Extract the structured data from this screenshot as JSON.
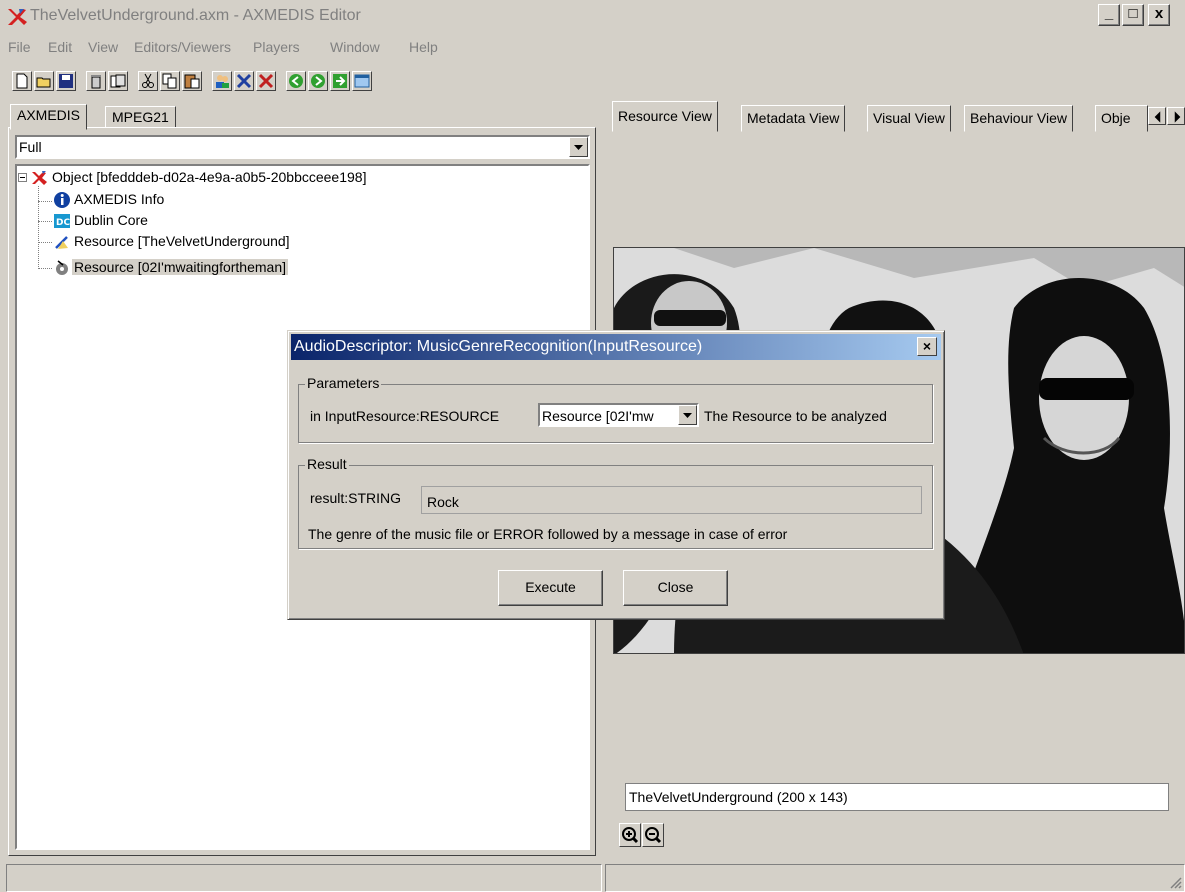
{
  "window": {
    "title": "TheVelvetUnderground.axm - AXMEDIS Editor",
    "caption_buttons": {
      "minimize": "_",
      "maximize": "□",
      "close": "x"
    }
  },
  "menu": [
    "File",
    "Edit",
    "View",
    "Editors/Viewers",
    "Players",
    "Window",
    "Help"
  ],
  "toolbar": {
    "icons": [
      "new-file-icon",
      "open-folder-icon",
      "save-icon",
      "trash-icon",
      "cards-icon",
      "cut-icon",
      "copy-icon",
      "paste-icon",
      "people-icon",
      "tool-blue-icon",
      "tool-red-icon",
      "back-green-icon",
      "forward-green-icon",
      "enter-icon",
      "window-icon"
    ]
  },
  "left_panel": {
    "tabs": [
      "AXMEDIS",
      "MPEG21"
    ],
    "active_tab": "AXMEDIS",
    "filter": {
      "value": "Full"
    },
    "tree": {
      "root": {
        "label": "Object [bfedddeb-d02a-4e9a-a0b5-20bbcceee198]",
        "icon": "axmedis-object-icon"
      },
      "children": [
        {
          "label": "AXMEDIS Info",
          "icon": "info-icon"
        },
        {
          "label": "Dublin Core",
          "icon": "dublin-core-icon"
        },
        {
          "label": "Resource [TheVelvetUnderground]",
          "icon": "image-resource-icon"
        },
        {
          "label": "Resource [02I'mwaitingfortheman]",
          "icon": "audio-resource-icon",
          "selected": true
        }
      ]
    }
  },
  "right_panel": {
    "tabs": [
      "Resource View",
      "Metadata View",
      "Visual View",
      "Behaviour View",
      "Obje"
    ],
    "active_tab": "Resource View",
    "caption": "TheVelvetUnderground  (200 x 143)",
    "zoom_in": "zoom-in-icon",
    "zoom_out": "zoom-out-icon"
  },
  "dialog": {
    "title": "AudioDescriptor: MusicGenreRecognition(InputResource)",
    "parameters": {
      "group_label": "Parameters",
      "input_label": "in InputResource:RESOURCE",
      "select_value": "Resource [02I'mw",
      "description": "The Resource to be analyzed"
    },
    "result": {
      "group_label": "Result",
      "label": "result:STRING",
      "value": "Rock",
      "description": "The genre of the music file or ERROR followed by a message in case of error"
    },
    "buttons": {
      "execute": "Execute",
      "close": "Close"
    }
  }
}
